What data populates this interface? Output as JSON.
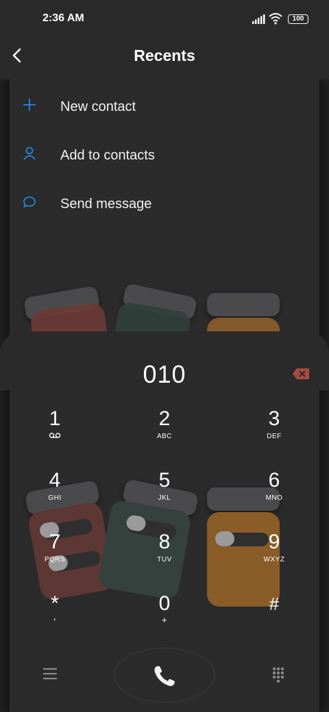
{
  "status_bar": {
    "time": "2:36 AM",
    "battery": "100"
  },
  "header": {
    "title": "Recents"
  },
  "actions": [
    {
      "label": "New contact",
      "icon": "plus-icon"
    },
    {
      "label": "Add to contacts",
      "icon": "person-icon"
    },
    {
      "label": "Send message",
      "icon": "message-icon"
    }
  ],
  "dialer": {
    "number": "010",
    "keys": [
      {
        "digit": "1",
        "letters": ""
      },
      {
        "digit": "2",
        "letters": "ABC"
      },
      {
        "digit": "3",
        "letters": "DEF"
      },
      {
        "digit": "4",
        "letters": "GHI"
      },
      {
        "digit": "5",
        "letters": "JKL"
      },
      {
        "digit": "6",
        "letters": "MNO"
      },
      {
        "digit": "7",
        "letters": "PQRS"
      },
      {
        "digit": "8",
        "letters": "TUV"
      },
      {
        "digit": "9",
        "letters": "WXYZ"
      },
      {
        "digit": "*",
        "letters": ","
      },
      {
        "digit": "0",
        "letters": "+"
      },
      {
        "digit": "#",
        "letters": ""
      }
    ]
  },
  "colors": {
    "accent": "#1e88e5",
    "background": "#2a2a2a",
    "call_green": "#ffffff",
    "backspace_red": "#a94a44"
  }
}
